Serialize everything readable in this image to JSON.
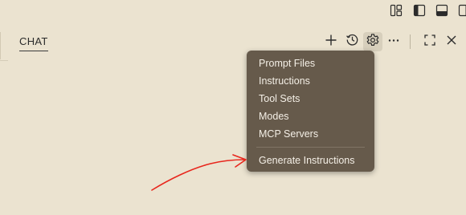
{
  "layout_controls": [
    {
      "name": "customize-layout",
      "icon": "customize-layout-icon"
    },
    {
      "name": "toggle-primary-sidebar",
      "icon": "primary-sidebar-icon"
    },
    {
      "name": "toggle-panel",
      "icon": "panel-icon"
    },
    {
      "name": "toggle-secondary-sidebar",
      "icon": "secondary-sidebar-icon"
    }
  ],
  "chat": {
    "tab_label": "CHAT",
    "toolbar": [
      {
        "name": "new-chat",
        "icon": "plus-icon"
      },
      {
        "name": "history",
        "icon": "history-icon"
      },
      {
        "name": "configure",
        "icon": "gear-icon",
        "active": true
      },
      {
        "name": "more-actions",
        "icon": "ellipsis-icon"
      },
      {
        "name": "maximize",
        "icon": "maximize-icon"
      },
      {
        "name": "close",
        "icon": "close-icon"
      }
    ]
  },
  "menu": {
    "items": [
      "Prompt Files",
      "Instructions",
      "Tool Sets",
      "Modes",
      "MCP Servers"
    ],
    "footer_item": "Generate Instructions"
  },
  "colors": {
    "background": "#ebe3d0",
    "menu_background": "#665a4b",
    "menu_text": "#f4efe6",
    "annotation_arrow": "#e8261c"
  }
}
